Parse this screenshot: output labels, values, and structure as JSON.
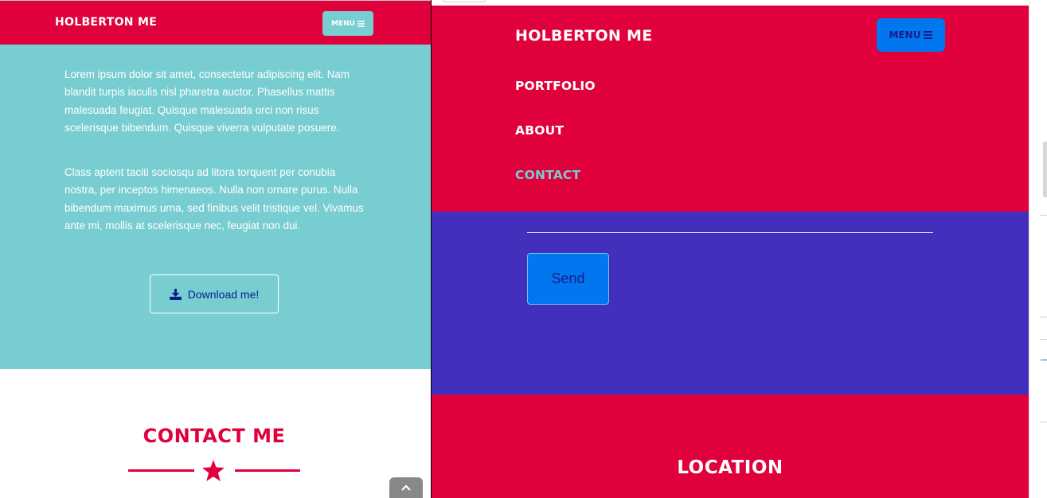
{
  "left": {
    "brand": "HOLBERTON ME",
    "menu_label": "MENU",
    "about_paragraphs": [
      "Lorem ipsum dolor sit amet, consectetur adipiscing elit. Nam blandit turpis iaculis nisl pharetra auctor. Phasellus mattis malesuada feugiat. Quisque malesuada orci non risus scelerisque bibendum. Quisque viverra vulputate posuere.",
      "Class aptent taciti sociosqu ad litora torquent per conubia nostra, per inceptos himenaeos. Nulla non ornare purus. Nulla bibendum maximus urna, sed finibus velit tristique vel. Vivamus ante mi, mollis at scelerisque nec, feugiat non dui."
    ],
    "download_label": "Download me!",
    "contact_title": "CONTACT ME"
  },
  "right": {
    "brand": "HOLBERTON ME",
    "menu_label": "MENU",
    "nav_links": [
      "PORTFOLIO",
      "ABOUT",
      "CONTACT"
    ],
    "active_link": "CONTACT",
    "send_label": "Send",
    "location_title": "LOCATION"
  },
  "icons": {
    "menu": "hamburger-icon",
    "download": "download-icon",
    "divider": "star-icon",
    "scroll_top": "chevron-up-icon"
  },
  "colors": {
    "primary_red": "#e0003c",
    "teal": "#78cdd1",
    "purple": "#4230bd",
    "blue": "#0077ee",
    "navy_text": "#1a1a8c"
  }
}
